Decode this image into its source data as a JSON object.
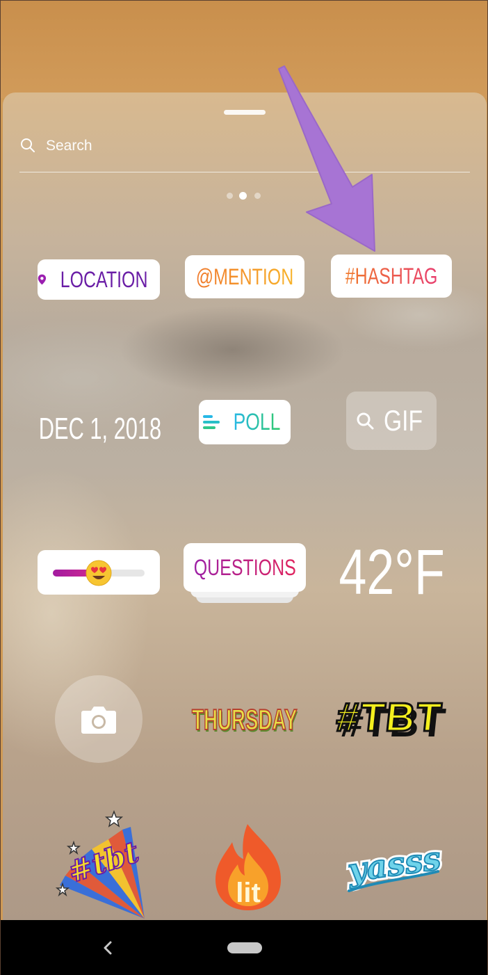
{
  "search": {
    "placeholder": "Search"
  },
  "pager": {
    "pages": 3,
    "active_index": 1
  },
  "stickers": {
    "location": "LOCATION",
    "mention": "@MENTION",
    "hashtag": "#HASHTAG",
    "date": "DEC 1, 2018",
    "poll": "POLL",
    "gif": "GIF",
    "emoji_slider": {
      "emoji": "😍"
    },
    "questions": "QUESTIONS",
    "temperature": "42°F",
    "day": "THURSDAY",
    "tbt": "#TBT",
    "tbt_burst": "#tbt",
    "lit": "lit",
    "yass": "yasss"
  },
  "colors": {
    "top_bar": "#c98f4c",
    "annotation_arrow": "#a774d4",
    "nav_bar": "#000000"
  }
}
